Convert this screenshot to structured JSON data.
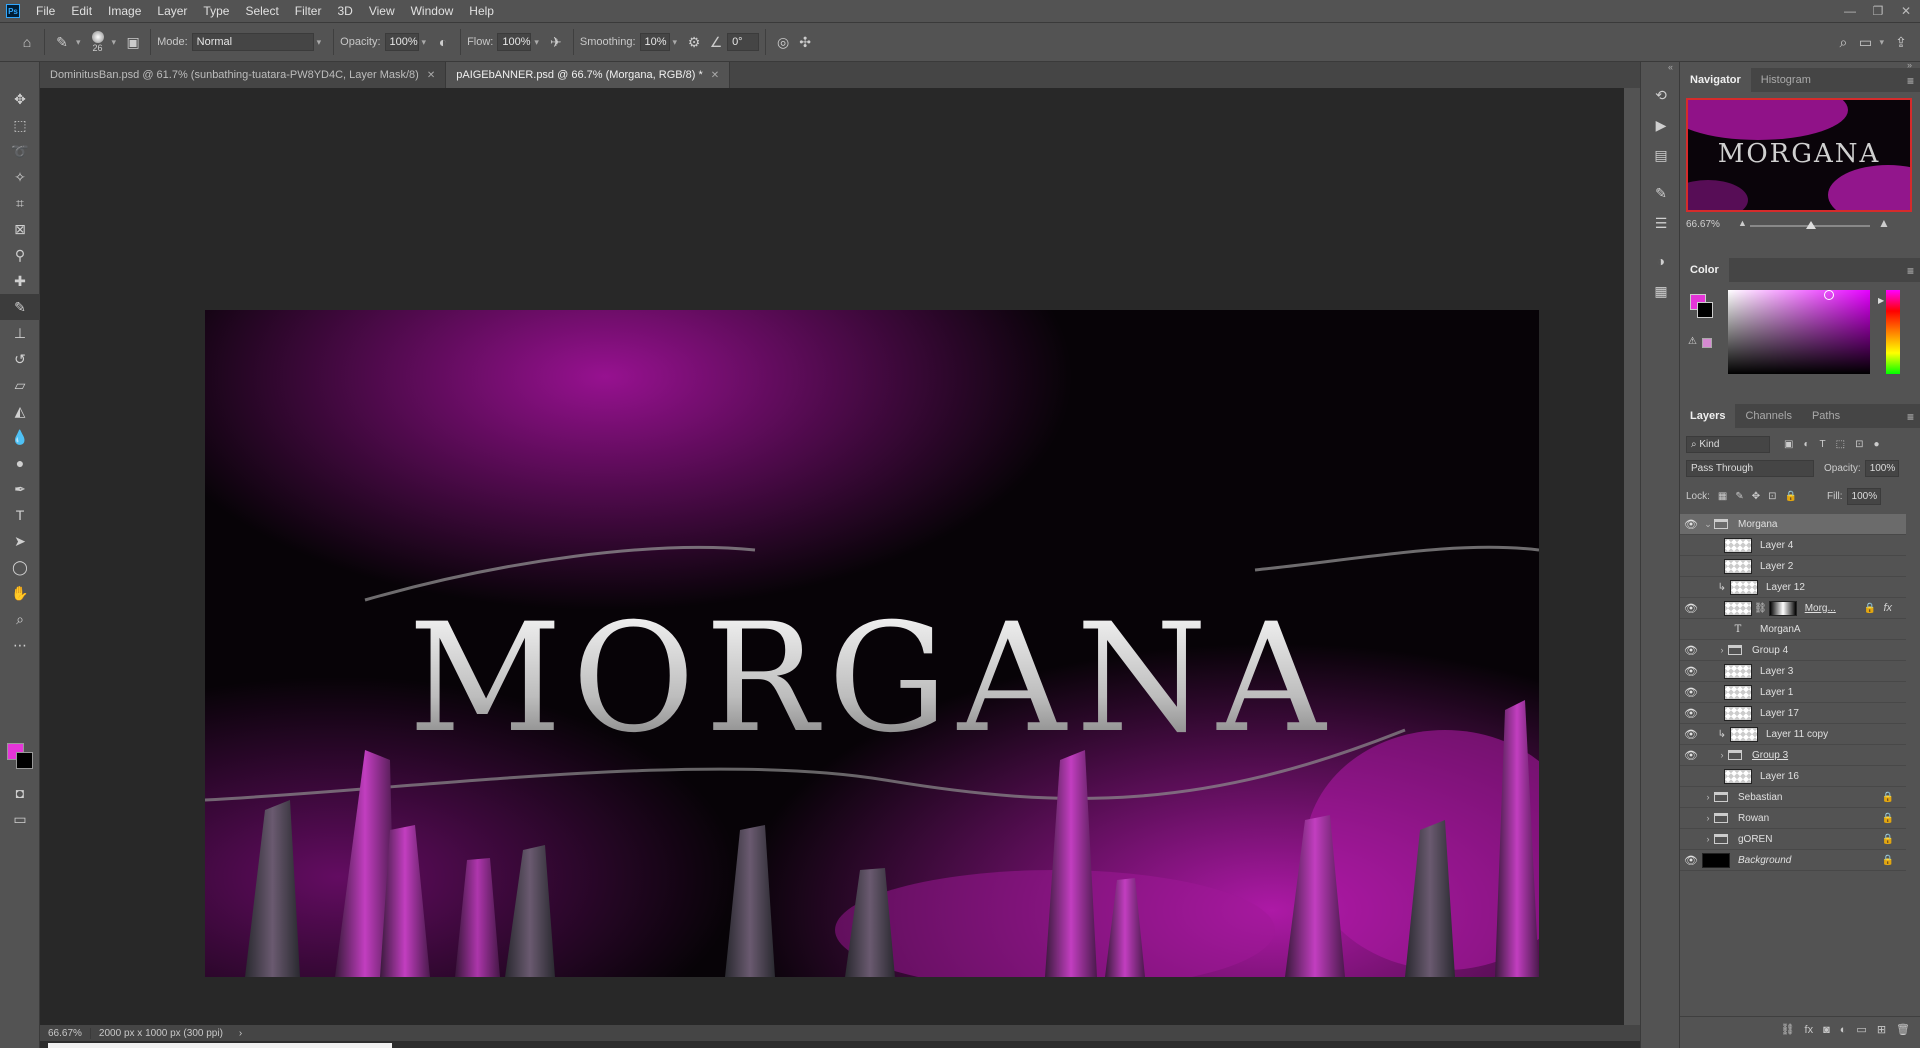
{
  "app": {
    "logo": "Ps"
  },
  "menu": [
    "File",
    "Edit",
    "Image",
    "Layer",
    "Type",
    "Select",
    "Filter",
    "3D",
    "View",
    "Window",
    "Help"
  ],
  "options_bar": {
    "brush_size": "26",
    "mode_label": "Mode:",
    "mode_value": "Normal",
    "opacity_label": "Opacity:",
    "opacity_value": "100%",
    "flow_label": "Flow:",
    "flow_value": "100%",
    "smoothing_label": "Smoothing:",
    "smoothing_value": "10%",
    "angle_value": "0°"
  },
  "tabs": [
    {
      "label": "DominitusBan.psd @ 61.7% (sunbathing-tuatara-PW8YD4C, Layer Mask/8)"
    },
    {
      "label": "pAIGEbANNER.psd @ 66.7% (Morgana, RGB/8) *"
    }
  ],
  "canvas": {
    "title_text": "MORGANA"
  },
  "status": {
    "zoom": "66.67%",
    "doc_info": "2000 px x 1000 px (300 ppi)"
  },
  "panels": {
    "navigator_tabs": [
      "Navigator",
      "Histogram"
    ],
    "navigator_zoom": "66.67%",
    "navigator_thumb_text": "MORGANA",
    "color_tab": "Color",
    "layers_tabs": [
      "Layers",
      "Channels",
      "Paths"
    ],
    "filter_kind": "Kind",
    "blend_mode": "Pass Through",
    "opacity_label": "Opacity:",
    "opacity_value": "100%",
    "lock_label": "Lock:",
    "fill_label": "Fill:",
    "fill_value": "100%"
  },
  "colors": {
    "foreground": "#e535d8",
    "background": "#000000"
  },
  "layers": [
    {
      "name": "Morgana",
      "type": "group-open",
      "visible": true,
      "selected": true
    },
    {
      "name": "Layer 4",
      "type": "pixel",
      "visible": false
    },
    {
      "name": "Layer 2",
      "type": "pixel",
      "visible": false
    },
    {
      "name": "Layer 12",
      "type": "clipped-pixel",
      "visible": false
    },
    {
      "name": "Morg...",
      "type": "masked-fx",
      "visible": true
    },
    {
      "name": "MorganA",
      "type": "text",
      "visible": false
    },
    {
      "name": "Group 4",
      "type": "group",
      "visible": true
    },
    {
      "name": "Layer 3",
      "type": "pixel",
      "visible": true
    },
    {
      "name": "Layer 1",
      "type": "pixel",
      "visible": true
    },
    {
      "name": "Layer 17",
      "type": "pixel",
      "visible": true
    },
    {
      "name": "Layer 11 copy",
      "type": "clipped-pixel",
      "visible": true
    },
    {
      "name": "Group 3",
      "type": "group",
      "visible": true
    },
    {
      "name": "Layer 16",
      "type": "pixel",
      "visible": false
    },
    {
      "name": "Sebastian",
      "type": "group-top",
      "visible": false,
      "locked": true
    },
    {
      "name": "Rowan",
      "type": "group-top",
      "visible": false,
      "locked": true
    },
    {
      "name": "gOREN",
      "type": "group-top",
      "visible": false,
      "locked": true
    },
    {
      "name": "Background",
      "type": "background",
      "visible": true,
      "locked": true
    }
  ]
}
